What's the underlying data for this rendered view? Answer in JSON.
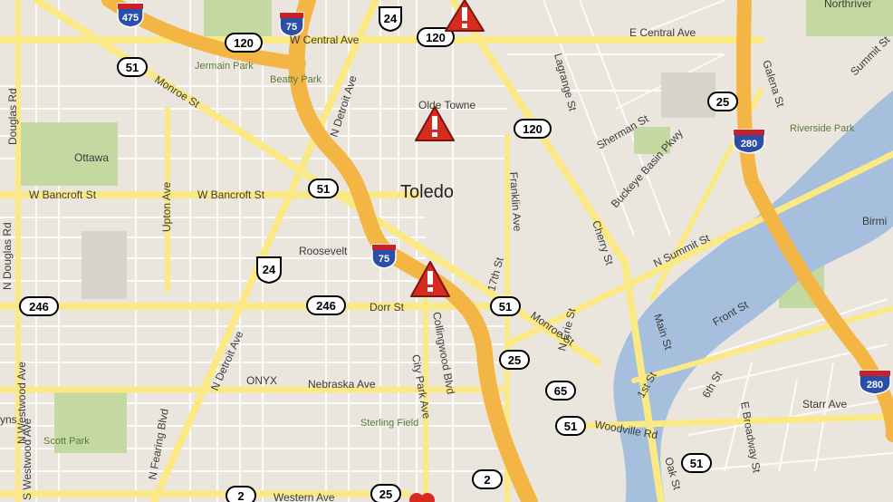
{
  "map": {
    "city_label": "Toledo",
    "neighborhoods": [
      "Ottawa",
      "Olde Towne",
      "Roosevelt",
      "ONYX",
      "Northriver",
      "Birmi"
    ],
    "parks": [
      "Jermain Park",
      "Beatty Park",
      "Riverside Park",
      "Scott Park",
      "Sterling Field"
    ],
    "streets": {
      "w_central": "W Central Ave",
      "e_central": "E Central Ave",
      "w_bancroft_left": "W Bancroft St",
      "w_bancroft_right": "W Bancroft St",
      "monroe_upper": "Monroe St",
      "monroe_lower": "Monroe St",
      "n_detroit_upper": "N Detroit Ave",
      "n_detroit_lower": "N Detroit Ave",
      "douglas": "Douglas Rd",
      "n_douglas": "N Douglas Rd",
      "upton": "Upton Ave",
      "dorr": "Dorr St",
      "nebraska": "Nebraska Ave",
      "collingwood": "Collingwood Blvd",
      "city_park": "City Park Ave",
      "n_westwood": "N Westwood Ave",
      "s_westwood": "S Westwood Ave",
      "n_fearing": "N Fearing Blvd",
      "western": "Western Ave",
      "franklin": "Franklin Ave",
      "17th": "17th St",
      "lagrange": "Lagrange St",
      "sherman": "Sherman St",
      "buckeye": "Buckeye Basin Pkwy",
      "cherry": "Cherry St",
      "n_summit": "N Summit St",
      "summit": "Summit St",
      "galena": "Galena St",
      "n_erie": "N Erie St",
      "main": "Main St",
      "front": "Front St",
      "first": "1st St",
      "sixth": "6th St",
      "starr": "Starr Ave",
      "e_broadway": "E Broadway St",
      "woodville": "Woodville Rd",
      "oak": "Oak St",
      "yns": "yns"
    },
    "route_shields": [
      {
        "id": "us24-top",
        "type": "us",
        "number": "24"
      },
      {
        "id": "us24-mid",
        "type": "us",
        "number": "24"
      },
      {
        "id": "sr120-a",
        "type": "state",
        "number": "120"
      },
      {
        "id": "sr120-b",
        "type": "state",
        "number": "120"
      },
      {
        "id": "sr120-c",
        "type": "state",
        "number": "120"
      },
      {
        "id": "sr51-a",
        "type": "state",
        "number": "51"
      },
      {
        "id": "sr51-b",
        "type": "state",
        "number": "51"
      },
      {
        "id": "sr51-c",
        "type": "state",
        "number": "51"
      },
      {
        "id": "sr51-d",
        "type": "state",
        "number": "51"
      },
      {
        "id": "sr51-e",
        "type": "state",
        "number": "51"
      },
      {
        "id": "sr25-a",
        "type": "state",
        "number": "25"
      },
      {
        "id": "sr25-b",
        "type": "state",
        "number": "25"
      },
      {
        "id": "sr25-c",
        "type": "state",
        "number": "25"
      },
      {
        "id": "sr246-a",
        "type": "state",
        "number": "246"
      },
      {
        "id": "sr246-b",
        "type": "state",
        "number": "246"
      },
      {
        "id": "sr65",
        "type": "state",
        "number": "65"
      },
      {
        "id": "sr2-a",
        "type": "state",
        "number": "2"
      },
      {
        "id": "sr2-b",
        "type": "state",
        "number": "2"
      },
      {
        "id": "i475",
        "type": "interstate",
        "number": "475"
      },
      {
        "id": "i75-top",
        "type": "interstate",
        "number": "75"
      },
      {
        "id": "i75-mid",
        "type": "interstate",
        "number": "75"
      },
      {
        "id": "i280-top",
        "type": "interstate",
        "number": "280"
      },
      {
        "id": "i280-bot",
        "type": "interstate",
        "number": "280"
      }
    ],
    "alerts": [
      {
        "id": "alert-central"
      },
      {
        "id": "alert-olde-towne"
      },
      {
        "id": "alert-i75-dorr"
      },
      {
        "id": "alert-bottom"
      }
    ],
    "colors": {
      "background": "#ebe6dd",
      "freeway": "#f3b544",
      "arterial": "#fbe985",
      "river": "#a5bfdd",
      "park": "#c3d9a1",
      "alert": "#d72b20"
    }
  }
}
